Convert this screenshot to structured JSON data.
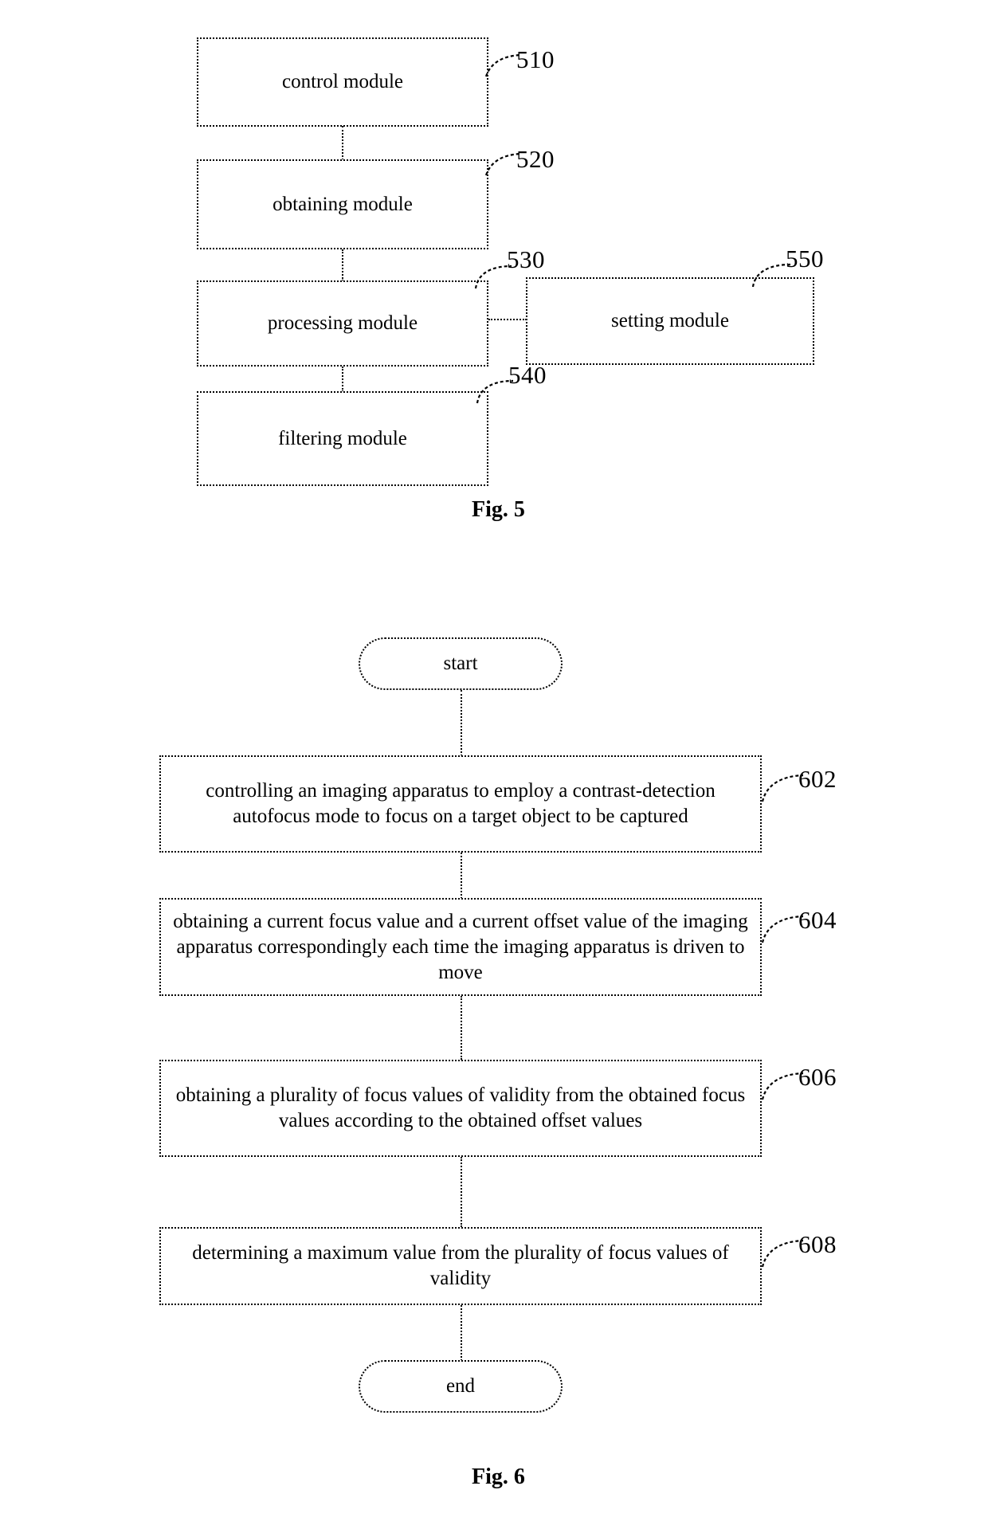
{
  "document": {
    "type": "patent-figure-sheet",
    "figures": [
      "Fig. 5",
      "Fig. 6"
    ]
  },
  "fig5": {
    "caption": "Fig. 5",
    "modules": [
      {
        "id": "control",
        "label": "control module",
        "ref": "510"
      },
      {
        "id": "obtaining",
        "label": "obtaining module",
        "ref": "520"
      },
      {
        "id": "processing",
        "label": "processing module",
        "ref": "530"
      },
      {
        "id": "filtering",
        "label": "filtering module",
        "ref": "540"
      },
      {
        "id": "setting",
        "label": "setting module",
        "ref": "550"
      }
    ]
  },
  "fig6": {
    "caption": "Fig. 6",
    "start_label": "start",
    "end_label": "end",
    "steps": [
      {
        "ref": "602",
        "text": "controlling an imaging apparatus to employ a contrast-detection autofocus mode to focus on a target object to be captured"
      },
      {
        "ref": "604",
        "text": "obtaining a current focus value and a current offset value of the imaging apparatus correspondingly each time the imaging apparatus is driven to move"
      },
      {
        "ref": "606",
        "text": "obtaining a plurality of focus values of validity from the obtained focus values according to the obtained offset values"
      },
      {
        "ref": "608",
        "text": "determining a maximum value from the plurality of focus values of validity"
      }
    ]
  },
  "colors": {
    "ink": "#000000",
    "paper": "#ffffff"
  }
}
